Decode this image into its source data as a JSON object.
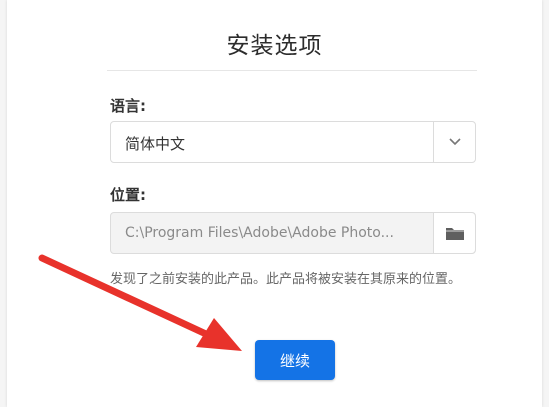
{
  "dialog": {
    "title": "安装选项"
  },
  "language": {
    "label": "语言:",
    "selected": "简体中文"
  },
  "location": {
    "label": "位置:",
    "path": "C:\\Program Files\\Adobe\\Adobe Photo..."
  },
  "notice": "发现了之前安装的此产品。此产品将被安装在其原来的位置。",
  "actions": {
    "continue_label": "继续"
  },
  "colors": {
    "primary_button": "#1473e6",
    "annotation_arrow": "#e8322b"
  },
  "icons": {
    "dropdown": "chevron-down-icon",
    "browse": "folder-icon"
  }
}
